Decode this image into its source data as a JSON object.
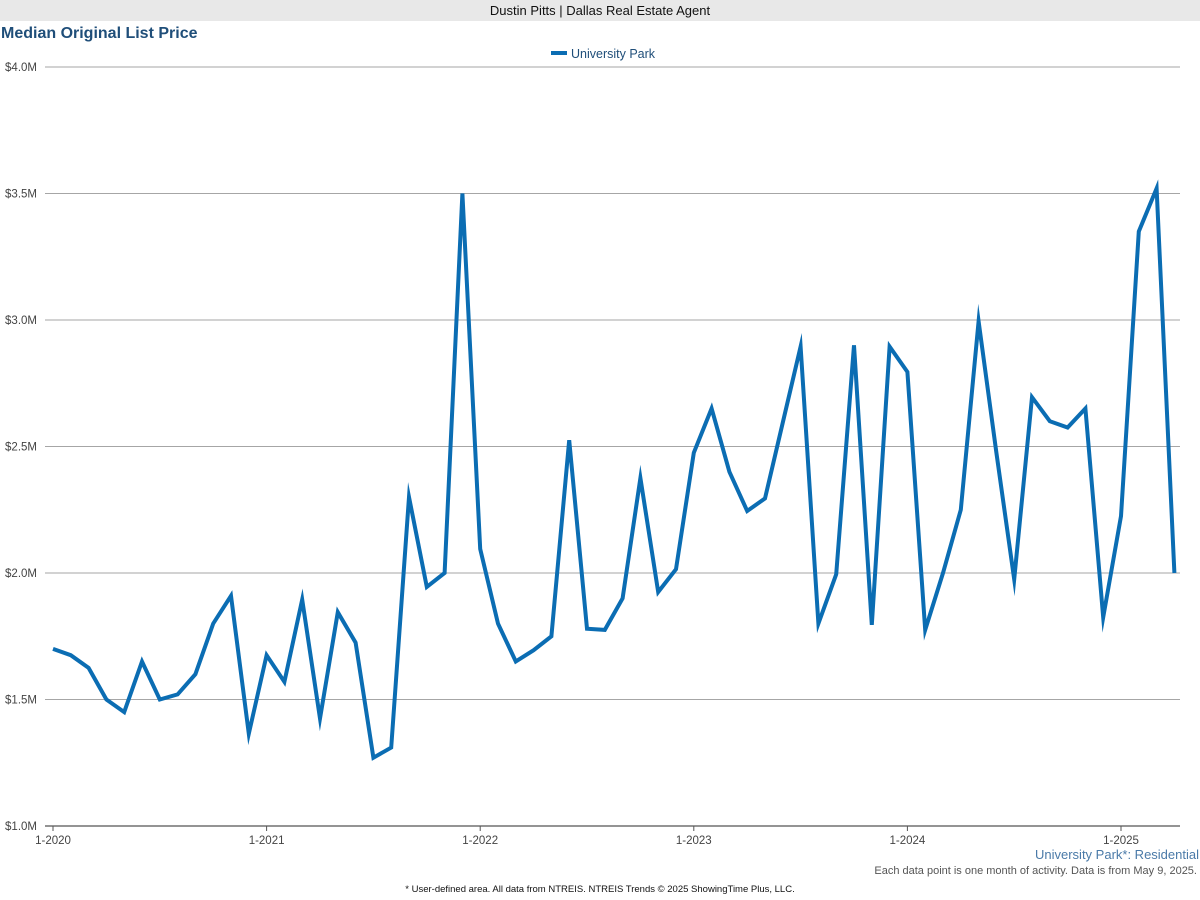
{
  "header": {
    "agent": "Dustin Pitts | Dallas Real Estate Agent"
  },
  "footer": {
    "region_label": "University Park*: Residential",
    "note": "Each data point is one month of activity. Data is from May 9, 2025.",
    "source": "* User-defined area. All data from NTREIS. NTREIS Trends © 2025 ShowingTime Plus, LLC."
  },
  "colors": {
    "line": "#0b6db3",
    "grid": "#a6a6a6",
    "title": "#1f4e79"
  },
  "chart_data": {
    "type": "line",
    "title": "Median Original List Price",
    "xlabel": "",
    "ylabel": "",
    "legend_position": "top-center",
    "grid": "horizontal",
    "ylim": [
      1000000,
      4000000
    ],
    "y_ticks": [
      1000000,
      1500000,
      2000000,
      2500000,
      3000000,
      3500000,
      4000000
    ],
    "y_tick_labels": [
      "$1.0M",
      "$1.5M",
      "$2.0M",
      "$2.5M",
      "$3.0M",
      "$3.5M",
      "$4.0M"
    ],
    "x_ticks": [
      "2020-01",
      "2021-01",
      "2022-01",
      "2023-01",
      "2024-01",
      "2025-01"
    ],
    "x_tick_labels": [
      "1-2020",
      "1-2021",
      "1-2022",
      "1-2023",
      "1-2024",
      "1-2025"
    ],
    "x": [
      "2020-01",
      "2020-02",
      "2020-03",
      "2020-04",
      "2020-05",
      "2020-06",
      "2020-07",
      "2020-08",
      "2020-09",
      "2020-10",
      "2020-11",
      "2020-12",
      "2021-01",
      "2021-02",
      "2021-03",
      "2021-04",
      "2021-05",
      "2021-06",
      "2021-07",
      "2021-08",
      "2021-09",
      "2021-10",
      "2021-11",
      "2021-12",
      "2022-01",
      "2022-02",
      "2022-03",
      "2022-04",
      "2022-05",
      "2022-06",
      "2022-07",
      "2022-08",
      "2022-09",
      "2022-10",
      "2022-11",
      "2022-12",
      "2023-01",
      "2023-02",
      "2023-03",
      "2023-04",
      "2023-05",
      "2023-06",
      "2023-07",
      "2023-08",
      "2023-09",
      "2023-10",
      "2023-11",
      "2023-12",
      "2024-01",
      "2024-02",
      "2024-03",
      "2024-04",
      "2024-05",
      "2024-06",
      "2024-07",
      "2024-08",
      "2024-09",
      "2024-10",
      "2024-11",
      "2024-12",
      "2025-01",
      "2025-02",
      "2025-03",
      "2025-04"
    ],
    "series": [
      {
        "name": "University Park",
        "values": [
          1700000,
          1675000,
          1625000,
          1500000,
          1450000,
          1650000,
          1500000,
          1520000,
          1600000,
          1800000,
          1910000,
          1365000,
          1675000,
          1570000,
          1895000,
          1425000,
          1845000,
          1725000,
          1270000,
          1310000,
          2300000,
          1945000,
          2000000,
          3500000,
          2095000,
          1800000,
          1650000,
          1695000,
          1750000,
          2525000,
          1780000,
          1775000,
          1900000,
          2375000,
          1925000,
          2015000,
          2475000,
          2650000,
          2400000,
          2245000,
          2295000,
          2595000,
          2895000,
          1800000,
          1995000,
          2900000,
          1795000,
          2895000,
          2795000,
          1775000,
          2000000,
          2250000,
          2995000,
          2475000,
          1975000,
          2695000,
          2600000,
          2575000,
          2650000,
          1825000,
          2225000,
          3350000,
          3520000,
          2000000
        ]
      }
    ]
  }
}
